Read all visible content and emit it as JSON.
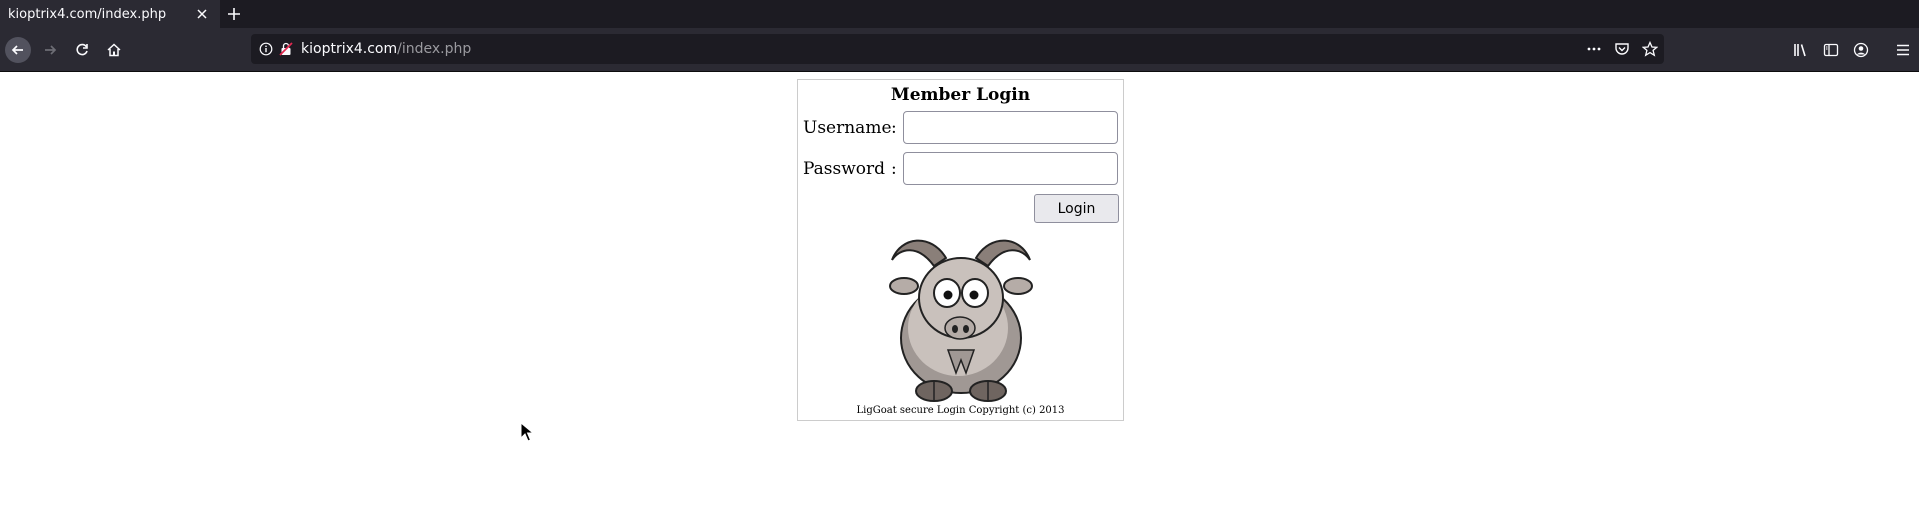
{
  "browser": {
    "tab_title": "kioptrix4.com/index.php",
    "url_host": "kioptrix4.com",
    "url_path": "/index.php"
  },
  "login": {
    "title": "Member Login",
    "username_label": "Username",
    "password_label": "Password",
    "colon": ":",
    "username_value": "",
    "password_value": "",
    "button_label": "Login",
    "copyright": "LigGoat secure Login Copyright (c) 2013"
  },
  "icons": {
    "tab_close": "close-icon",
    "new_tab": "plus-icon",
    "back": "arrow-left-icon",
    "forward": "arrow-right-icon",
    "reload": "reload-icon",
    "home": "home-icon",
    "site_info": "info-icon",
    "insecure": "insecure-lock-icon",
    "page_actions": "more-dots-icon",
    "pocket": "pocket-icon",
    "bookmark": "star-icon",
    "library": "library-icon",
    "sidebar": "sidebar-icon",
    "account": "account-icon",
    "menu": "hamburger-menu-icon",
    "mascot": "goat-mascot-image",
    "pointer": "mouse-pointer-icon"
  },
  "colors": {
    "chrome_bg": "#2b2a33",
    "tabbar_bg": "#1c1b22",
    "page_bg": "#ffffff",
    "button_bg": "#e9e9ed"
  }
}
